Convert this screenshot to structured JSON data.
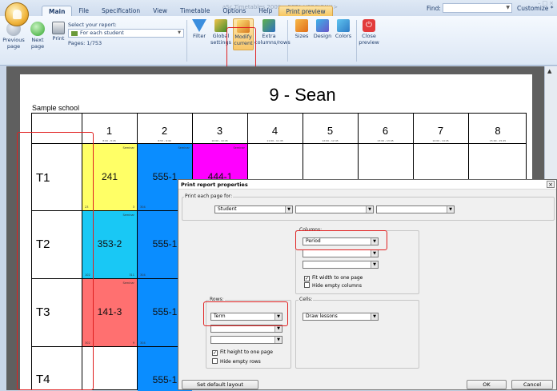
{
  "app": {
    "title": "aSc Timetables 2009  <BETA VERSION!!>",
    "tabs": [
      "Main",
      "File",
      "Specification",
      "View",
      "Timetable",
      "Options",
      "Help",
      "Print preview"
    ],
    "find_label": "Find:",
    "customize_label": "Customize *"
  },
  "ribbon": {
    "previous_page": "Previous page",
    "next_page": "Next page",
    "print": "Print",
    "select_report_label": "Select your report:",
    "report_value": "For each student",
    "pages": "Pages: 1/753",
    "filter": "Filter",
    "global_settings": "Global settings",
    "modify_current": "Modify current",
    "extra_columns": "Extra columns/rows",
    "sizes": "Sizes",
    "design": "Design",
    "colors": "Colors",
    "close_preview": "Close preview"
  },
  "timetable": {
    "title": "9 - Sean",
    "school": "Sample school",
    "periods": [
      {
        "num": "1",
        "time": "8:00 - 8:45"
      },
      {
        "num": "2",
        "time": "8:55 - 9:40"
      },
      {
        "num": "3",
        "time": "10:00 - 10:45"
      },
      {
        "num": "4",
        "time": "11:00 - 11:45"
      },
      {
        "num": "5",
        "time": "12:00 - 12:45"
      },
      {
        "num": "6",
        "time": "13:00 - 13:45"
      },
      {
        "num": "7",
        "time": "14:00 - 14:45"
      },
      {
        "num": "8",
        "time": "15:00 - 15:45"
      }
    ],
    "rows": [
      "T1",
      "T2",
      "T3",
      "T4"
    ],
    "lessons": [
      {
        "lesson": "241",
        "tag": "Seminar",
        "room_a": "23",
        "room_b": "3",
        "color": "#ffff66"
      },
      {
        "lesson": "555-1",
        "tag": "Seminar",
        "room_a": "304",
        "room_b": "",
        "color": "#0a8dff"
      },
      {
        "lesson": "444-1",
        "tag": "Seminar",
        "room_a": "",
        "room_b": "",
        "color": "#ff00ff"
      },
      {
        "lesson": "353-2",
        "tag": "Seminar",
        "room_a": "102",
        "room_b": "311",
        "color": "#19c8f5"
      },
      {
        "lesson": "555-1",
        "tag": "",
        "room_a": "304",
        "room_b": "",
        "color": "#0a8dff"
      },
      {
        "lesson": "141-3",
        "tag": "Seminar",
        "room_a": "302",
        "room_b": "9",
        "color": "#ff7070"
      },
      {
        "lesson": "555-1",
        "tag": "",
        "room_a": "304",
        "room_b": "",
        "color": "#0a8dff"
      },
      {
        "lesson": "555-1",
        "tag": "",
        "room_a": "",
        "room_b": "",
        "color": "#0a8dff"
      }
    ]
  },
  "dialog": {
    "title": "Print report properties",
    "print_each_label": "Print each page for:",
    "print_each_value": "Student",
    "columns_label": "Columns:",
    "columns_value": "Period",
    "fit_width": "Fit width to one page",
    "hide_empty_columns": "Hide empty columns",
    "rows_label": "Rows:",
    "rows_value": "Term",
    "fit_height": "Fit height to one page",
    "hide_empty_rows": "Hide empty rows",
    "cells_label": "Cells:",
    "cells_value": "Draw lessons",
    "set_default": "Set default layout",
    "ok": "OK",
    "cancel": "Cancel"
  }
}
